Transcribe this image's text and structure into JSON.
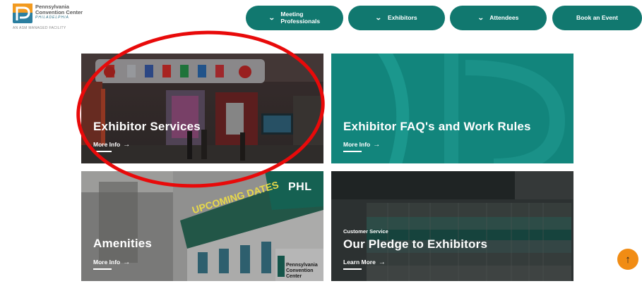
{
  "header": {
    "logo": {
      "line1": "Pennsylvania",
      "line2": "Convention Center",
      "line3": "PHILADELPHIA",
      "sub": "AN ASM MANAGED FACILITY"
    },
    "nav": [
      {
        "label_line1": "Meeting",
        "label_line2": "Professionals",
        "icon": "chevron-down-icon"
      },
      {
        "label_line1": "Exhibitors",
        "label_line2": "",
        "icon": "chevron-down-icon"
      },
      {
        "label_line1": "Attendees",
        "label_line2": "",
        "icon": "chevron-down-icon"
      },
      {
        "label_line1": "Book an Event",
        "label_line2": ""
      }
    ]
  },
  "tiles": [
    {
      "eyebrow": "",
      "title": "Exhibitor Services",
      "link": "More Info",
      "arrow": "→"
    },
    {
      "eyebrow": "",
      "title": "Exhibitor FAQ's and Work Rules",
      "link": "More Info",
      "arrow": "→"
    },
    {
      "eyebrow": "",
      "title": "Amenities",
      "link": "More Info",
      "arrow": "→"
    },
    {
      "eyebrow": "Customer Service",
      "title": "Our Pledge to Exhibitors",
      "link": "Learn More",
      "arrow": "→"
    }
  ],
  "photo_text": {
    "phl": "PHL",
    "upcoming": "UPCOMING DATES",
    "sign_line1": "Pennsylvania",
    "sign_line2": "Convention Center"
  },
  "back_to_top": "↑",
  "colors": {
    "brand_teal": "#11786f",
    "tile_teal": "#12857c",
    "annotation_red": "#e80a0a",
    "back_to_top": "#f18c14"
  }
}
